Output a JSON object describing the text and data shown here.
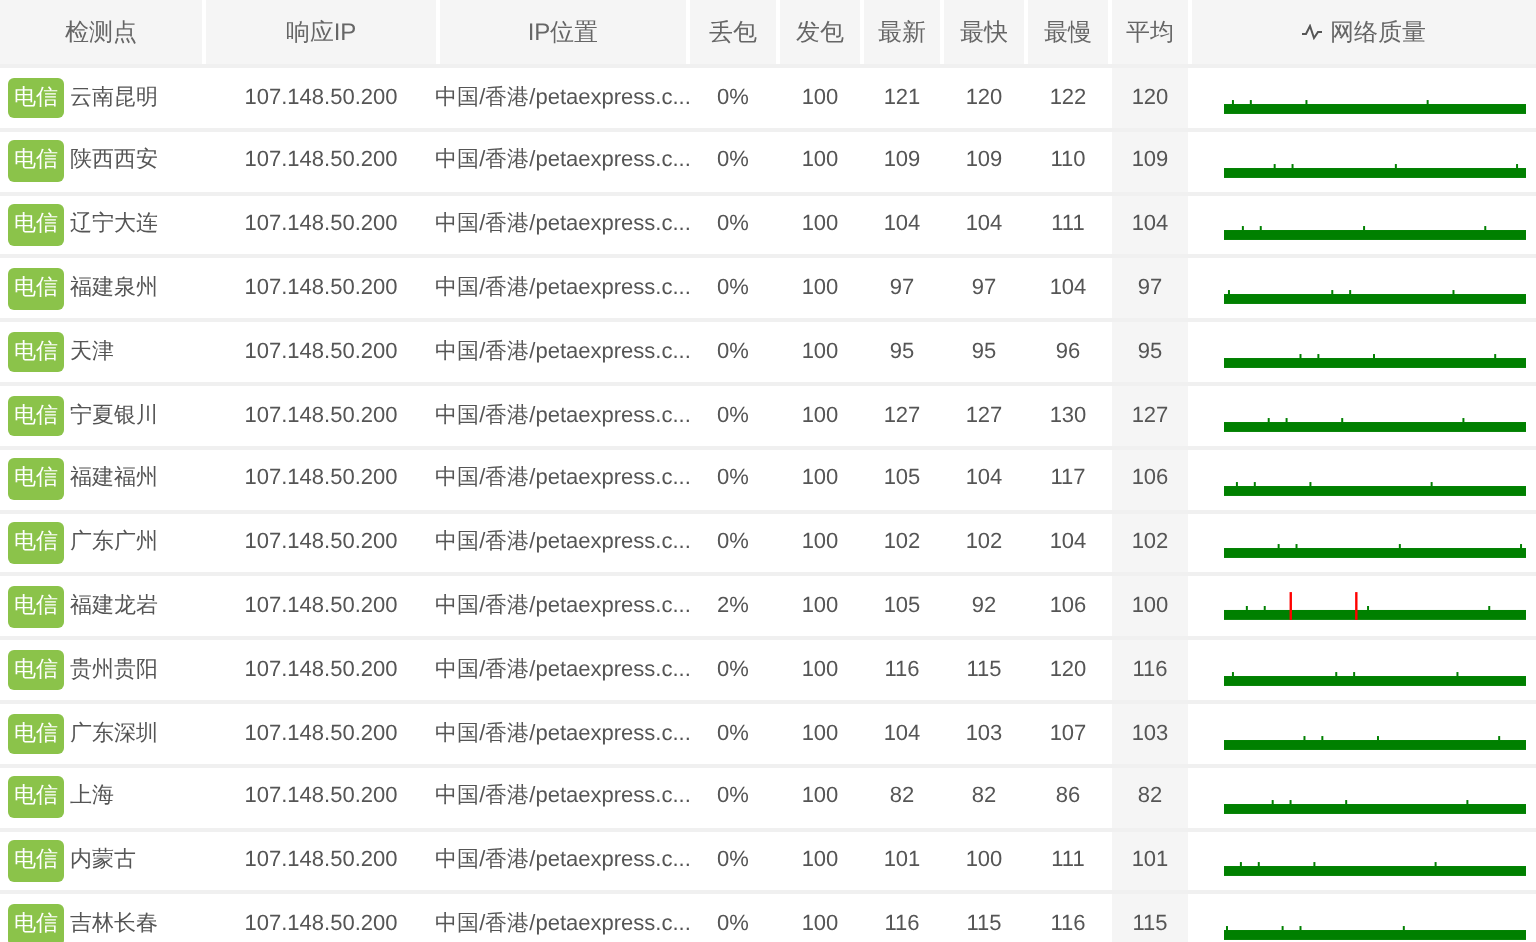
{
  "table": {
    "columns": [
      "检测点",
      "响应IP",
      "IP位置",
      "丢包",
      "发包",
      "最新",
      "最快",
      "最慢",
      "平均",
      "网络质量"
    ],
    "rows": [
      {
        "isp": "电信",
        "location": "云南昆明",
        "ip": "107.148.50.200",
        "ip_location": "中国/香港/petaexpress.c...",
        "loss": "0%",
        "sent": "100",
        "latest": "121",
        "fastest": "120",
        "slowest": "122",
        "average": "120",
        "loss_spikes": false
      },
      {
        "isp": "电信",
        "location": "陕西西安",
        "ip": "107.148.50.200",
        "ip_location": "中国/香港/petaexpress.c...",
        "loss": "0%",
        "sent": "100",
        "latest": "109",
        "fastest": "109",
        "slowest": "110",
        "average": "109",
        "loss_spikes": false
      },
      {
        "isp": "电信",
        "location": "辽宁大连",
        "ip": "107.148.50.200",
        "ip_location": "中国/香港/petaexpress.c...",
        "loss": "0%",
        "sent": "100",
        "latest": "104",
        "fastest": "104",
        "slowest": "111",
        "average": "104",
        "loss_spikes": false
      },
      {
        "isp": "电信",
        "location": "福建泉州",
        "ip": "107.148.50.200",
        "ip_location": "中国/香港/petaexpress.c...",
        "loss": "0%",
        "sent": "100",
        "latest": "97",
        "fastest": "97",
        "slowest": "104",
        "average": "97",
        "loss_spikes": false
      },
      {
        "isp": "电信",
        "location": "天津",
        "ip": "107.148.50.200",
        "ip_location": "中国/香港/petaexpress.c...",
        "loss": "0%",
        "sent": "100",
        "latest": "95",
        "fastest": "95",
        "slowest": "96",
        "average": "95",
        "loss_spikes": false
      },
      {
        "isp": "电信",
        "location": "宁夏银川",
        "ip": "107.148.50.200",
        "ip_location": "中国/香港/petaexpress.c...",
        "loss": "0%",
        "sent": "100",
        "latest": "127",
        "fastest": "127",
        "slowest": "130",
        "average": "127",
        "loss_spikes": false
      },
      {
        "isp": "电信",
        "location": "福建福州",
        "ip": "107.148.50.200",
        "ip_location": "中国/香港/petaexpress.c...",
        "loss": "0%",
        "sent": "100",
        "latest": "105",
        "fastest": "104",
        "slowest": "117",
        "average": "106",
        "loss_spikes": false
      },
      {
        "isp": "电信",
        "location": "广东广州",
        "ip": "107.148.50.200",
        "ip_location": "中国/香港/petaexpress.c...",
        "loss": "0%",
        "sent": "100",
        "latest": "102",
        "fastest": "102",
        "slowest": "104",
        "average": "102",
        "loss_spikes": false
      },
      {
        "isp": "电信",
        "location": "福建龙岩",
        "ip": "107.148.50.200",
        "ip_location": "中国/香港/petaexpress.c...",
        "loss": "2%",
        "sent": "100",
        "latest": "105",
        "fastest": "92",
        "slowest": "106",
        "average": "100",
        "loss_spikes": true
      },
      {
        "isp": "电信",
        "location": "贵州贵阳",
        "ip": "107.148.50.200",
        "ip_location": "中国/香港/petaexpress.c...",
        "loss": "0%",
        "sent": "100",
        "latest": "116",
        "fastest": "115",
        "slowest": "120",
        "average": "116",
        "loss_spikes": false
      },
      {
        "isp": "电信",
        "location": "广东深圳",
        "ip": "107.148.50.200",
        "ip_location": "中国/香港/petaexpress.c...",
        "loss": "0%",
        "sent": "100",
        "latest": "104",
        "fastest": "103",
        "slowest": "107",
        "average": "103",
        "loss_spikes": false
      },
      {
        "isp": "电信",
        "location": "上海",
        "ip": "107.148.50.200",
        "ip_location": "中国/香港/petaexpress.c...",
        "loss": "0%",
        "sent": "100",
        "latest": "82",
        "fastest": "82",
        "slowest": "86",
        "average": "82",
        "loss_spikes": false
      },
      {
        "isp": "电信",
        "location": "内蒙古",
        "ip": "107.148.50.200",
        "ip_location": "中国/香港/petaexpress.c...",
        "loss": "0%",
        "sent": "100",
        "latest": "101",
        "fastest": "100",
        "slowest": "111",
        "average": "101",
        "loss_spikes": false
      },
      {
        "isp": "电信",
        "location": "吉林长春",
        "ip": "107.148.50.200",
        "ip_location": "中国/香港/petaexpress.c...",
        "loss": "0%",
        "sent": "100",
        "latest": "116",
        "fastest": "115",
        "slowest": "116",
        "average": "115",
        "loss_spikes": false
      }
    ]
  }
}
